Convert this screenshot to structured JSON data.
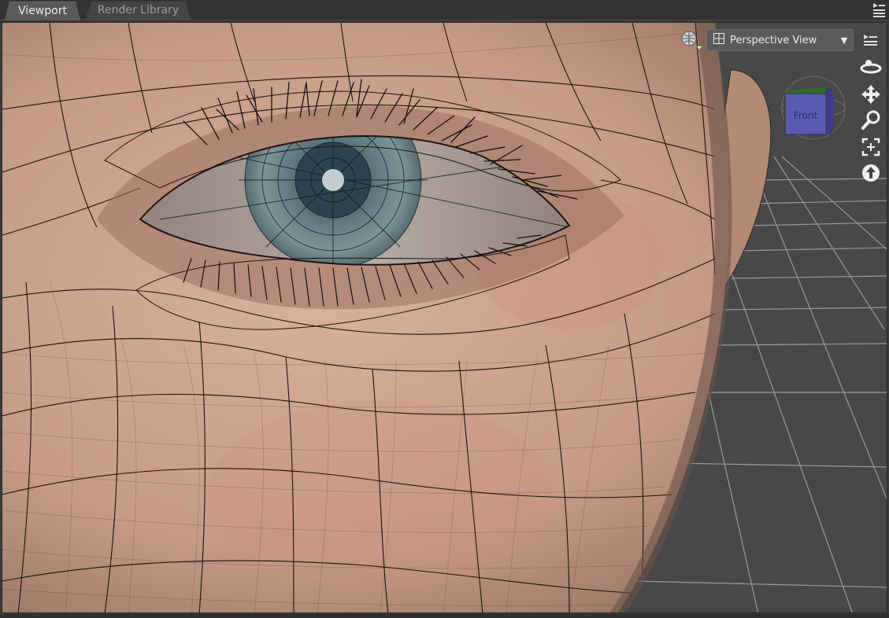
{
  "tabs": [
    {
      "label": "Viewport",
      "active": true
    },
    {
      "label": "Render Library",
      "active": false
    }
  ],
  "viewport": {
    "camera_select": {
      "selected": "Perspective View"
    },
    "view_cube": {
      "face_label": "Front"
    },
    "nav_tools": [
      "orbit-icon",
      "pan-icon",
      "zoom-icon",
      "frame-icon",
      "reset-icon"
    ]
  },
  "colors": {
    "skin": "#c49a84",
    "iris": "#6d8a90",
    "floor": "#474747",
    "grid": "#9a9a9a",
    "cube": "#5b5bb4"
  }
}
